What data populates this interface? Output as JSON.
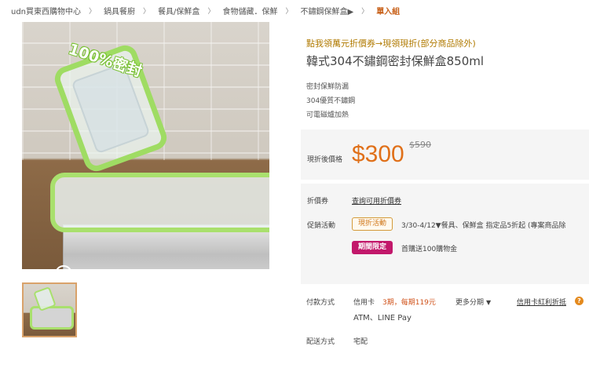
{
  "breadcrumb": {
    "items": [
      "udn買東西購物中心",
      "鍋具餐廚",
      "餐具/保鮮盒",
      "食物儲藏．保鮮",
      "不鏽鋼保鮮盒▶"
    ],
    "current": "單入組",
    "separator": "〉"
  },
  "image": {
    "overlay_text": "100%密封",
    "zoom_icon": "zoom-in-icon"
  },
  "product": {
    "promo_link": "點我領萬元折價券→現領現折(部分商品除外)",
    "title": "韓式304不鏽鋼密封保鮮盒850ml",
    "features": [
      "密封保鮮防漏",
      "304優質不鏽鋼",
      "可電磁爐加熱"
    ]
  },
  "price": {
    "label": "現折後價格",
    "current": "$300",
    "original": "$590"
  },
  "coupon": {
    "label": "折價券",
    "link": "查詢可用折價券"
  },
  "promotion": {
    "label": "促銷活動",
    "badge": "現折活動",
    "description": "3/30-4/12▼餐具、保鮮盒 指定品5折起 (專案商品除",
    "limited_badge": "期間限定",
    "limited_description": "首購送100購物金"
  },
  "payment": {
    "label": "付款方式",
    "card": "信用卡",
    "installment": "3期，每期119元",
    "more": "更多分期",
    "bonus_link": "信用卡紅利折抵",
    "other": "ATM、LINE Pay"
  },
  "shipping": {
    "label": "配送方式",
    "value": "宅配"
  },
  "colors": {
    "price": "#e07019",
    "link": "#b07a00",
    "limited_badge": "#c2186b",
    "lid_green": "#a9e06d"
  }
}
